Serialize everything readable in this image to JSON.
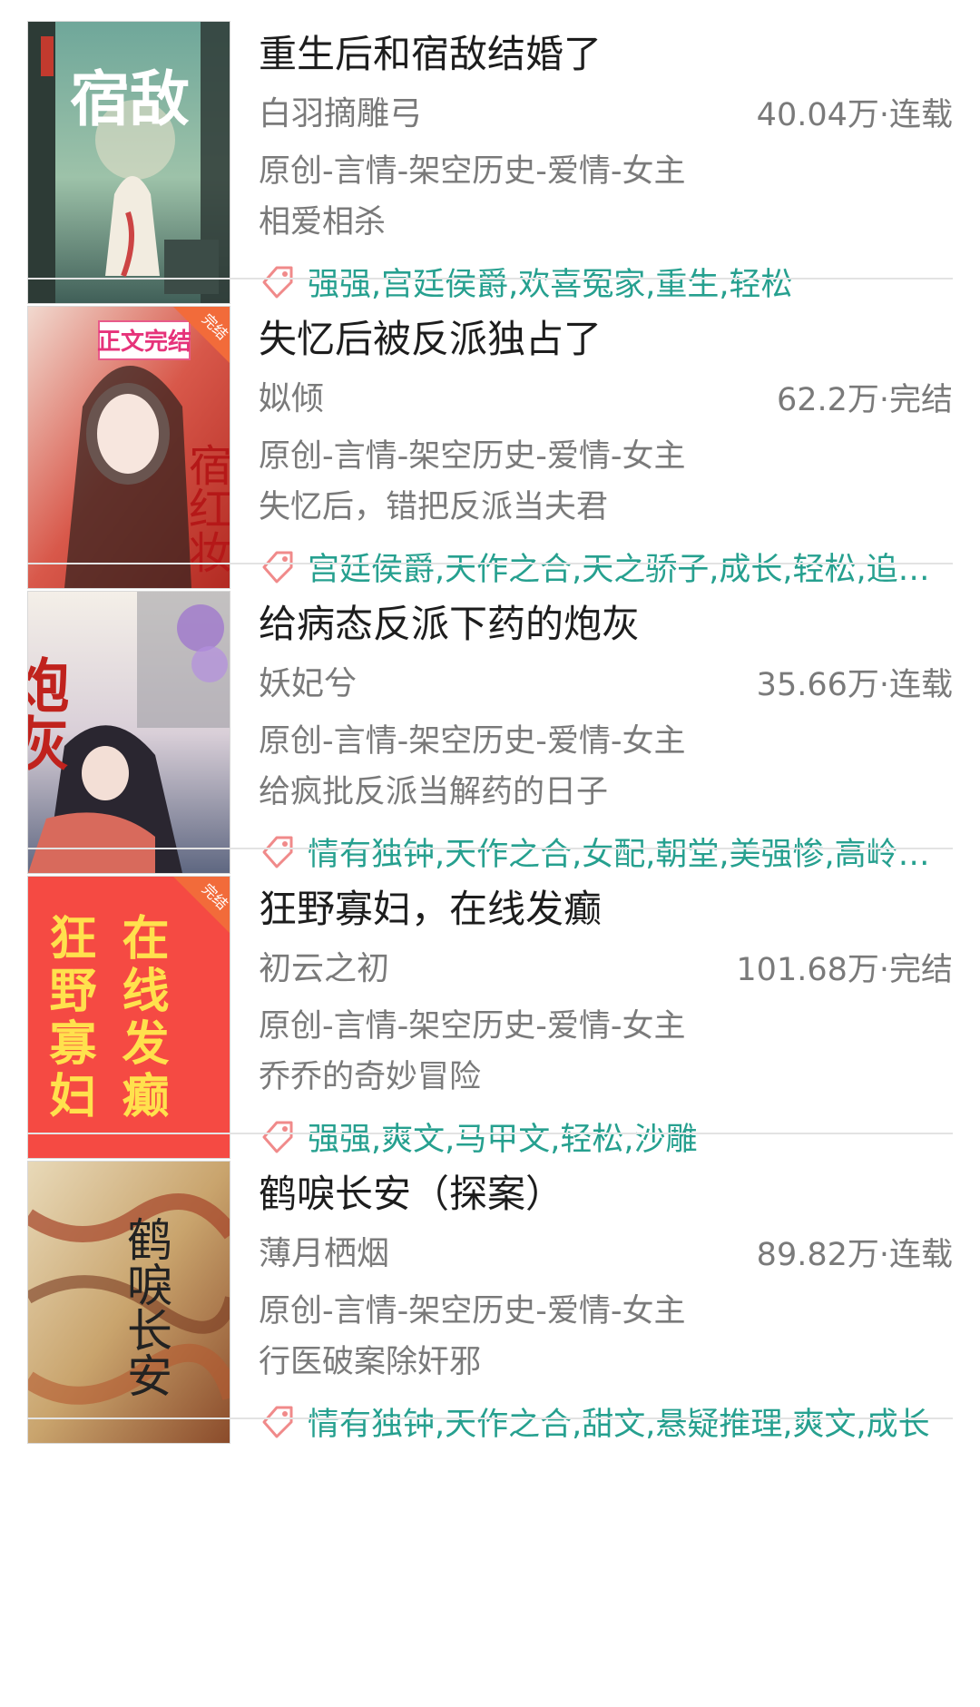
{
  "books": [
    {
      "title": "重生后和宿敌结婚了",
      "author": "白羽摘雕弓",
      "stats": "40.04万·连载",
      "category": "原创-言情-架空历史-爱情-女主",
      "description": "相爱相杀",
      "tags": "强强,宫廷侯爵,欢喜冤家,重生,轻松",
      "cover": {
        "theme": "teal",
        "text": "宿敌",
        "badge": ""
      }
    },
    {
      "title": "失忆后被反派独占了",
      "author": "姒倾",
      "stats": "62.2万·完结",
      "category": "原创-言情-架空历史-爱情-女主",
      "description": "失忆后，错把反派当夫君",
      "tags": "宫廷侯爵,天作之合,天之骄子,成长,轻松,追爱火葬场",
      "cover": {
        "theme": "red",
        "text": "宿红妆",
        "badge": "完结",
        "banner": "正文完结"
      }
    },
    {
      "title": "给病态反派下药的炮灰",
      "author": "妖妃兮",
      "stats": "35.66万·连载",
      "category": "原创-言情-架空历史-爱情-女主",
      "description": "给疯批反派当解药的日子",
      "tags": "情有独钟,天作之合,女配,朝堂,美强惨,高岭之花",
      "cover": {
        "theme": "purple",
        "text": "炮灰",
        "badge": ""
      }
    },
    {
      "title": "狂野寡妇，在线发癫",
      "author": "初云之初",
      "stats": "101.68万·完结",
      "category": "原创-言情-架空历史-爱情-女主",
      "description": "乔乔的奇妙冒险",
      "tags": "强强,爽文,马甲文,轻松,沙雕",
      "cover": {
        "theme": "plainred",
        "col1": "狂野寡妇",
        "col2": "在线发癫",
        "badge": "完结"
      }
    },
    {
      "title": "鹤唳长安（探案）",
      "author": "薄月栖烟",
      "stats": "89.82万·连载",
      "category": "原创-言情-架空历史-爱情-女主",
      "description": "行医破案除奸邪",
      "tags": "情有独钟,天作之合,甜文,悬疑推理,爽文,成长",
      "cover": {
        "theme": "marble",
        "text": "鹤唳长安",
        "badge": ""
      }
    }
  ],
  "colors": {
    "accent": "#26a08f",
    "tagIcon": "#f08a8a",
    "badge": "#f26b3a",
    "plainCover": "#f54a43",
    "plainCoverText": "#ffe14d"
  }
}
